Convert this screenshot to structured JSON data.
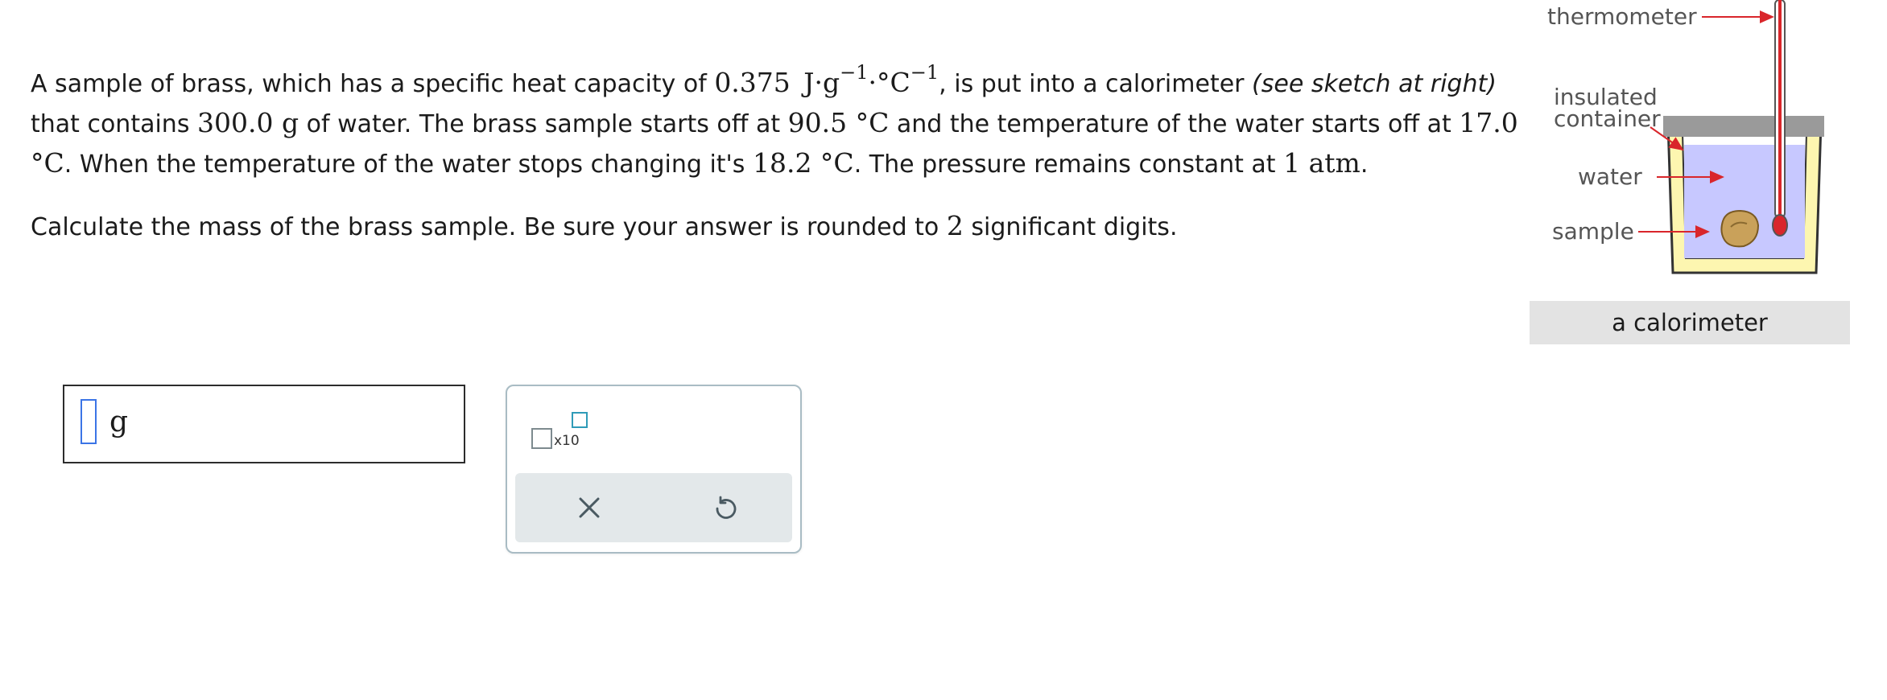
{
  "problem": {
    "p1": {
      "t1": "A sample of brass, which has a specific heat capacity of ",
      "m1": "0.375",
      "m1_unit": "J·g",
      "m1_exp1": "−1",
      "m1_mid": "·°C",
      "m1_exp2": "−1",
      "t2": ", is put into a calorimeter ",
      "t2_italic": "(see sketch at right)",
      "t3": " that contains ",
      "m2": "300.0 g",
      "t4": " of water. The brass sample starts off at ",
      "m3": "90.5 °C",
      "t5": " and the temperature of the water starts off at ",
      "m4": "17.0 °C",
      "t6": ". When the temperature of the water stops changing it's ",
      "m5": "18.2 °C",
      "t7": ". The pressure remains constant at ",
      "m6": "1 atm",
      "t8": "."
    },
    "p2": {
      "t1": "Calculate the mass of the brass sample. Be sure your answer is rounded to ",
      "m1": "2",
      "t2": " significant digits."
    }
  },
  "figure": {
    "labels": {
      "thermometer": "thermometer",
      "insulated_line1": "insulated",
      "insulated_line2": "container",
      "water": "water",
      "sample": "sample"
    },
    "caption": "a calorimeter",
    "colors": {
      "water": "#c7c8ff",
      "container": "#fdf6b0",
      "arrow": "#d9262b",
      "lid": "#9a9a9a",
      "sample": "#c9a15a"
    }
  },
  "answer": {
    "unit": "g"
  },
  "tools": {
    "sci_notation_text": "x10",
    "clear_icon": "x-icon",
    "undo_icon": "undo-icon"
  }
}
